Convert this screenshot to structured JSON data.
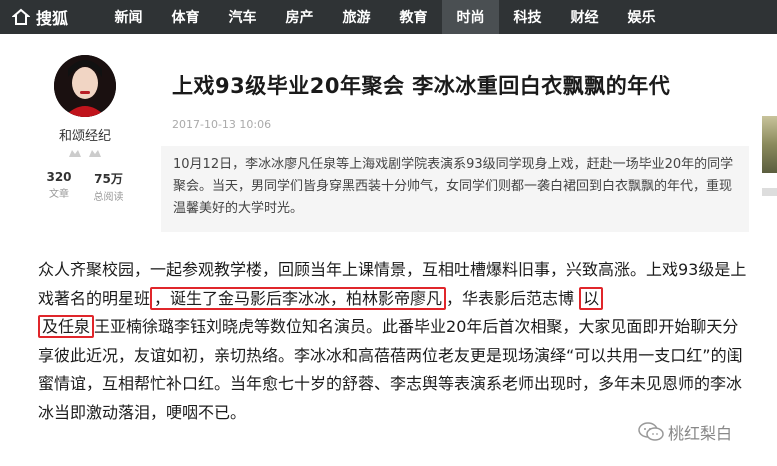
{
  "nav": {
    "logo_text": "搜狐",
    "items": [
      "新闻",
      "体育",
      "汽车",
      "房产",
      "旅游",
      "教育",
      "时尚",
      "科技",
      "财经",
      "娱乐"
    ],
    "active": "时尚"
  },
  "author": {
    "name": "和颂经纪",
    "stats": [
      {
        "num": "320",
        "label": "文章"
      },
      {
        "num": "75万",
        "label": "总阅读"
      }
    ]
  },
  "article": {
    "title": "上戏93级毕业20年聚会 李冰冰重回白衣飘飘的年代",
    "date": "2017-10-13 10:06",
    "summary": "10月12日，李冰冰廖凡任泉等上海戏剧学院表演系93级同学现身上戏，赶赴一场毕业20年的同学聚会。当天，男同学们皆身穿黑西装十分帅气，女同学们则都一袭白裙回到白衣飘飘的年代，重现温馨美好的大学时光。",
    "body": {
      "p1": "众人齐聚校园，一起参观教学楼，回顾当年上课情景，互相吐槽爆料旧事，兴致高涨。上戏93级是上戏著名的明星班",
      "hl1": "，诞生了金马影后李冰冰，柏林影帝廖凡",
      "p2": "，华表影后范志博",
      "hl2a": "以",
      "hl2b": "及任泉",
      "p3": "王亚楠徐璐李钰刘晓虎等数位知名演员。此番毕业20年后首次相聚，大家见面即开始聊天分享彼此近况，友谊如初，亲切热络。李冰冰和高蓓蓓两位老友更是现场演绎“可以共用一支口红”的闺蜜情谊，互相帮忙补口红。当年愈七十岁的舒蓉、李志舆等表演系老师出现时，多年未见恩师的李冰冰当即激动落泪，哽咽不已。"
    }
  },
  "watermark": "桃红梨白",
  "colors": {
    "nav_bg": "#2f3335",
    "highlight": "#e0262b"
  }
}
